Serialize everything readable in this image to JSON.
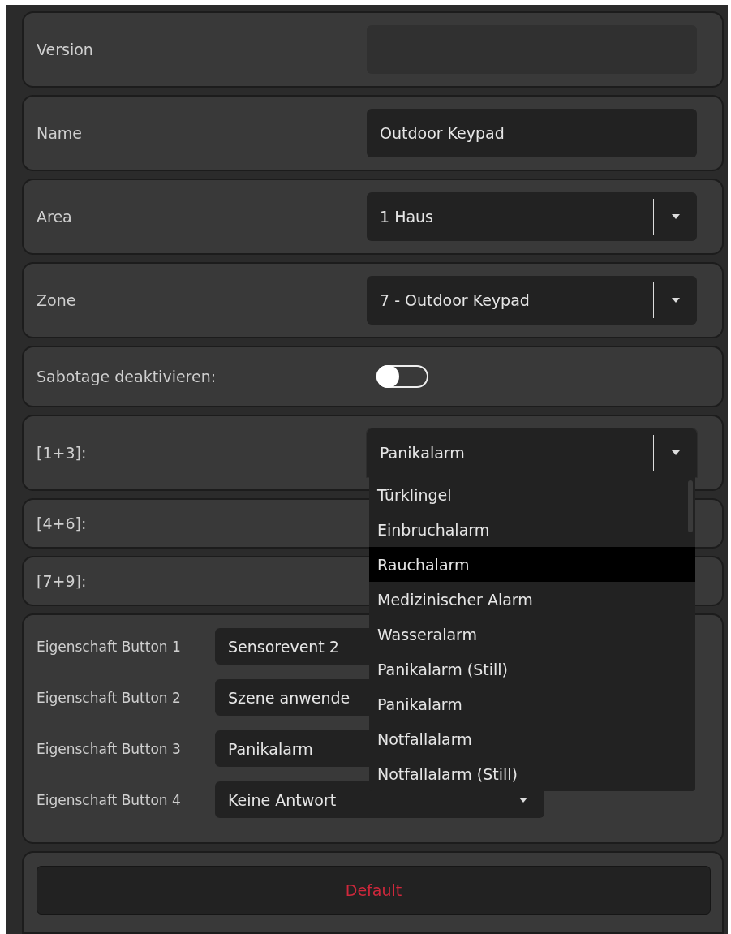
{
  "fields": [
    {
      "kind": "input",
      "label": "Version",
      "disabled": true
    },
    {
      "kind": "input",
      "label": "Name",
      "value": "Outdoor Keypad",
      "disabled": false
    },
    {
      "kind": "select",
      "label": "Area",
      "value": "1 Haus",
      "expanded": false
    },
    {
      "kind": "select",
      "label": "Zone",
      "value": "7 - Outdoor Keypad",
      "expanded": false
    },
    {
      "kind": "toggle",
      "label": "Sabotage deaktivieren:",
      "on": false
    },
    {
      "kind": "select",
      "label": "[1+3]:",
      "value": "Panikalarm",
      "expanded": true,
      "options": [
        {
          "label": "Türklingel",
          "highlighted": false
        },
        {
          "label": "Einbruchalarm",
          "highlighted": false
        },
        {
          "label": "Rauchalarm",
          "highlighted": true
        },
        {
          "label": "Medizinischer Alarm",
          "highlighted": false
        },
        {
          "label": "Wasseralarm",
          "highlighted": false
        },
        {
          "label": "Panikalarm (Still)",
          "highlighted": false
        },
        {
          "label": "Panikalarm",
          "highlighted": false
        },
        {
          "label": "Notfallalarm",
          "highlighted": false
        },
        {
          "label": "Notfallalarm (Still)",
          "highlighted": false
        }
      ]
    },
    {
      "kind": "label",
      "label": "[4+6]:"
    },
    {
      "kind": "label",
      "label": "[7+9]:"
    }
  ],
  "button_properties": [
    {
      "label": "Eigenschaft Button 1",
      "value": "Sensorevent 2"
    },
    {
      "label": "Eigenschaft Button 2",
      "value": "Szene anwende"
    },
    {
      "label": "Eigenschaft Button 3",
      "value": "Panikalarm"
    },
    {
      "label": "Eigenschaft Button 4",
      "value": "Keine Antwort"
    }
  ],
  "default_button": "Default"
}
